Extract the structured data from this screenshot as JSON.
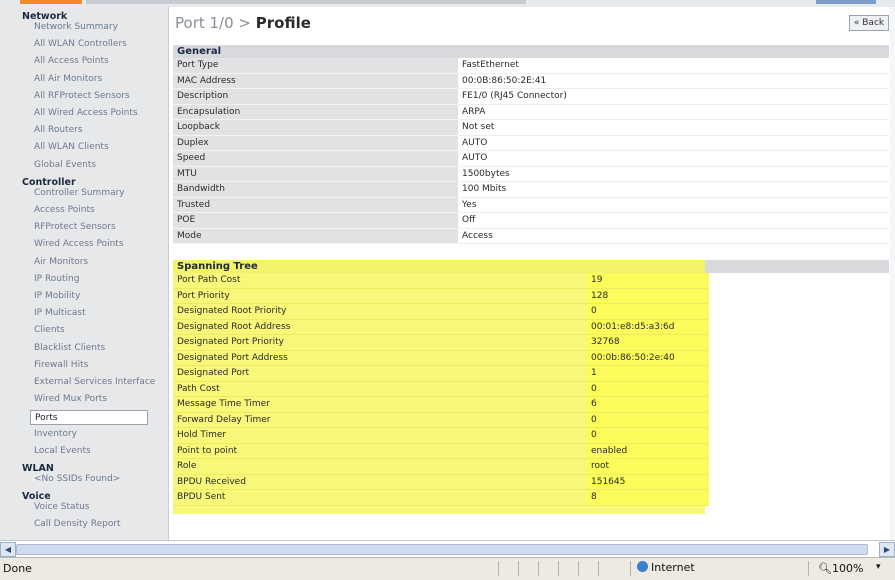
{
  "sidebar": {
    "sections": [
      {
        "title": "Network",
        "items": [
          "Network Summary",
          "All WLAN Controllers",
          "All Access Points",
          "All Air Monitors",
          "All RFProtect Sensors",
          "All Wired Access Points",
          "All Routers",
          "All WLAN Clients",
          "Global Events"
        ]
      },
      {
        "title": "Controller",
        "items": [
          "Controller Summary",
          "Access Points",
          "RFProtect Sensors",
          "Wired Access Points",
          "Air Monitors",
          "IP Routing",
          "IP Mobility",
          "IP Multicast",
          "Clients",
          "Blacklist Clients",
          "Firewall Hits",
          "External Services Interface",
          "Wired Mux Ports",
          "Ports",
          "Inventory",
          "Local Events"
        ]
      },
      {
        "title": "WLAN",
        "items": [
          "<No SSIDs Found>"
        ]
      },
      {
        "title": "Voice",
        "items": [
          "Voice Status",
          "Call Density Report"
        ]
      }
    ],
    "selected": "Ports"
  },
  "header": {
    "crumb_prefix": "Port 1/0 > ",
    "title": "Profile",
    "back_label": "« Back"
  },
  "general": {
    "title": "General",
    "rows": [
      [
        "Port Type",
        "FastEthernet"
      ],
      [
        "MAC Address",
        "00:0B:86:50:2E:41"
      ],
      [
        "Description",
        "FE1/0 (RJ45 Connector)"
      ],
      [
        "Encapsulation",
        "ARPA"
      ],
      [
        "Loopback",
        "Not set"
      ],
      [
        "Duplex",
        "AUTO"
      ],
      [
        "Speed",
        "AUTO"
      ],
      [
        "MTU",
        "1500bytes"
      ],
      [
        "Bandwidth",
        "100 Mbits"
      ],
      [
        "Trusted",
        "Yes"
      ],
      [
        "POE",
        "Off"
      ],
      [
        "Mode",
        "Access"
      ]
    ]
  },
  "spanning": {
    "title": "Spanning Tree",
    "highlight_color": "#f7f779",
    "rows": [
      [
        "Port Path Cost",
        "19"
      ],
      [
        "Port Priority",
        "128"
      ],
      [
        "Designated Root Priority",
        "0"
      ],
      [
        "Designated Root Address",
        "00:01:e8:d5:a3:6d"
      ],
      [
        "Designated Port Priority",
        "32768"
      ],
      [
        "Designated Port Address",
        "00:0b:86:50:2e:40"
      ],
      [
        "Designated Port",
        "1"
      ],
      [
        "Path Cost",
        "0"
      ],
      [
        "Message Time Timer",
        "6"
      ],
      [
        "Forward Delay Timer",
        "0"
      ],
      [
        "Hold Timer",
        "0"
      ],
      [
        "Point to point",
        "enabled"
      ],
      [
        "Role",
        "root"
      ],
      [
        "BPDU Received",
        "151645"
      ],
      [
        "BPDU Sent",
        "8"
      ]
    ]
  },
  "statusbar": {
    "status": "Done",
    "zone": "Internet",
    "zoom": "100%",
    "zoom_dropdown": "▾"
  },
  "scroll": {
    "left_arrow": "◀",
    "right_arrow": "▶"
  }
}
